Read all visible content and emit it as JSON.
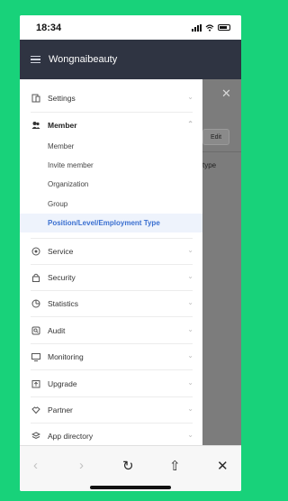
{
  "status_bar": {
    "time": "18:34"
  },
  "header": {
    "title": "Wongnaibeauty"
  },
  "backdrop": {
    "close": "✕",
    "edit_label": "Edit",
    "type_label": "type"
  },
  "menu": {
    "settings": "Settings",
    "member": "Member",
    "member_sub": [
      "Member",
      "Invite member",
      "Organization",
      "Group",
      "Position/Level/Employment Type"
    ],
    "service": "Service",
    "security": "Security",
    "statistics": "Statistics",
    "audit": "Audit",
    "monitoring": "Monitoring",
    "upgrade": "Upgrade",
    "partner": "Partner",
    "app_directory": "App directory"
  },
  "toolbar": {
    "back": "‹",
    "forward": "›",
    "reload": "↻",
    "share": "⇧",
    "close": "✕"
  },
  "icons": {
    "settings": "settings-icon",
    "member": "member-icon",
    "service": "service-icon",
    "security": "lock-icon",
    "statistics": "statistics-icon",
    "audit": "audit-icon",
    "monitoring": "monitor-icon",
    "upgrade": "upgrade-icon",
    "partner": "partner-icon",
    "app_directory": "app-directory-icon"
  },
  "colors": {
    "header_bg": "#2f3442",
    "active_sub_bg": "#eef3fc",
    "active_sub_text": "#3a6fd0",
    "frame": "#18d27a"
  }
}
